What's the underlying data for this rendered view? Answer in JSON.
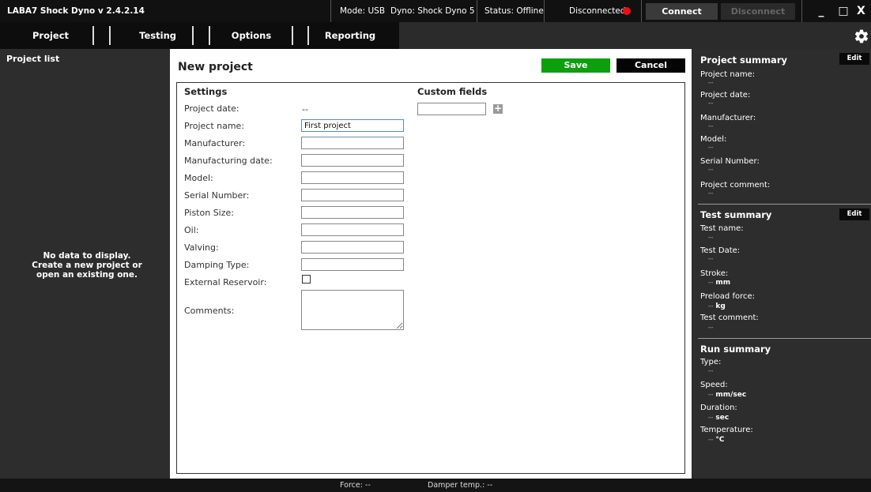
{
  "titlebar": {
    "app_title": "LABA7 Shock Dyno  v 2.4.2.14",
    "mode": "Mode: USB",
    "dyno": "Dyno: Shock Dyno 5",
    "status": "Status: Offline",
    "connection": "Disconnected",
    "connect_label": "Connect",
    "disconnect_label": "Disconnect",
    "minimize": "_",
    "maximize": "□",
    "close": "X"
  },
  "nav": {
    "tabs": [
      {
        "label": "Project"
      },
      {
        "label": "Testing"
      },
      {
        "label": "Options"
      },
      {
        "label": "Reporting"
      }
    ]
  },
  "left": {
    "title": "Project list",
    "empty_message": "No data to display. Create a new project or open an existing one."
  },
  "center": {
    "title": "New project",
    "save_label": "Save",
    "cancel_label": "Cancel",
    "settings_title": "Settings",
    "custom_fields_title": "Custom fields",
    "fields": {
      "project_date": {
        "label": "Project date:",
        "value": "--"
      },
      "project_name": {
        "label": "Project name:",
        "value": "First project"
      },
      "manufacturer": {
        "label": "Manufacturer:",
        "value": ""
      },
      "manufacturing_date": {
        "label": "Manufacturing date:",
        "value": ""
      },
      "model": {
        "label": "Model:",
        "value": ""
      },
      "serial_number": {
        "label": "Serial Number:",
        "value": ""
      },
      "piston_size": {
        "label": "Piston Size:",
        "value": ""
      },
      "oil": {
        "label": "Oil:",
        "value": ""
      },
      "valving": {
        "label": "Valving:",
        "value": ""
      },
      "damping_type": {
        "label": "Damping Type:",
        "value": ""
      },
      "external_reservoir": {
        "label": "External Reservoir:",
        "checked": false
      },
      "comments": {
        "label": "Comments:",
        "value": ""
      }
    },
    "add_field_glyph": "+"
  },
  "right": {
    "edit_label": "Edit",
    "project_summary": {
      "title": "Project summary",
      "project_name": {
        "label": "Project name:",
        "value": "--"
      },
      "project_date": {
        "label": "Project date:",
        "value": "--"
      },
      "manufacturer": {
        "label": "Manufacturer:",
        "value": "--"
      },
      "model": {
        "label": "Model:",
        "value": "--"
      },
      "serial_number": {
        "label": "Serial Number:",
        "value": "--"
      },
      "project_comment": {
        "label": "Project comment:",
        "value": "--"
      }
    },
    "test_summary": {
      "title": "Test summary",
      "test_name": {
        "label": "Test name:",
        "value": "--"
      },
      "test_date": {
        "label": "Test Date:",
        "value": "--"
      },
      "stroke": {
        "label": "Stroke:",
        "value": "--",
        "unit": "mm"
      },
      "preload_force": {
        "label": "Preload force:",
        "value": "--",
        "unit": "kg"
      },
      "test_comment": {
        "label": "Test comment:",
        "value": "--"
      }
    },
    "run_summary": {
      "title": "Run summary",
      "type": {
        "label": "Type:",
        "value": "--"
      },
      "speed": {
        "label": "Speed:",
        "value": "--",
        "unit": "mm/sec"
      },
      "duration": {
        "label": "Duration:",
        "value": "--",
        "unit": "sec"
      },
      "temperature": {
        "label": "Temperature:",
        "value": "--",
        "unit": "°C"
      }
    }
  },
  "statusbar": {
    "force": "Force:  --",
    "damper_temp": "Damper temp.:  --"
  },
  "colors": {
    "save_green": "#0e9f0e",
    "status_red": "#e81010",
    "input_focus": "#4c8fd1"
  }
}
